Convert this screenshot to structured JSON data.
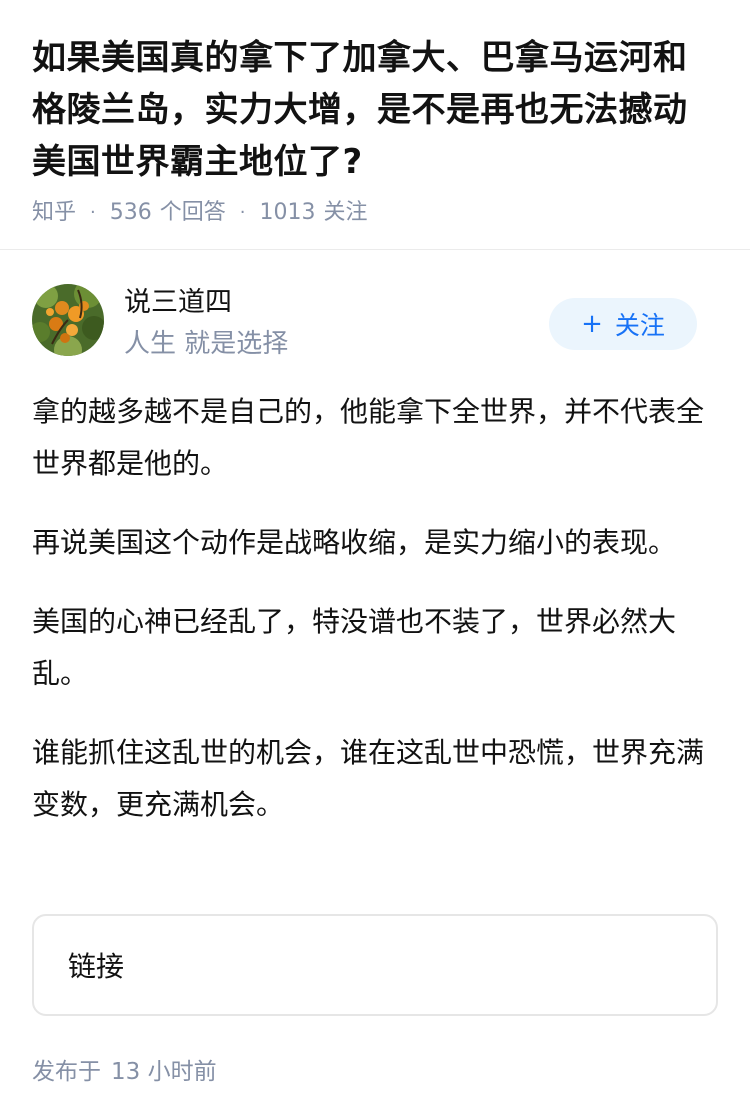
{
  "question": {
    "title": "如果美国真的拿下了加拿大、巴拿马运河和格陵兰岛，实力大增，是不是再也无法撼动美国世界霸主地位了?",
    "source": "知乎",
    "answer_count": "536",
    "answer_label": "个回答",
    "follow_count": "1013",
    "follow_label": "关注"
  },
  "author": {
    "name": "说三道四",
    "bio": "人生 就是选择",
    "avatar_icon": "avatar-fruit-tree",
    "follow_button": "关注"
  },
  "answer": {
    "paragraphs": [
      "拿的越多越不是自己的，他能拿下全世界，并不代表全世界都是他的。",
      "再说美国这个动作是战略收缩，是实力缩小的表现。",
      "美国的心神已经乱了，特没谱也不装了，世界必然大乱。",
      "谁能抓住这乱世的机会，谁在这乱世中恐慌，世界充满变数，更充满机会。"
    ],
    "link_label": "链接",
    "published_prefix": "发布于",
    "published_time": "13 小时前"
  },
  "colors": {
    "accent": "#1772f6",
    "meta_gray": "#8590a6",
    "follow_bg": "#ebf5fd"
  }
}
